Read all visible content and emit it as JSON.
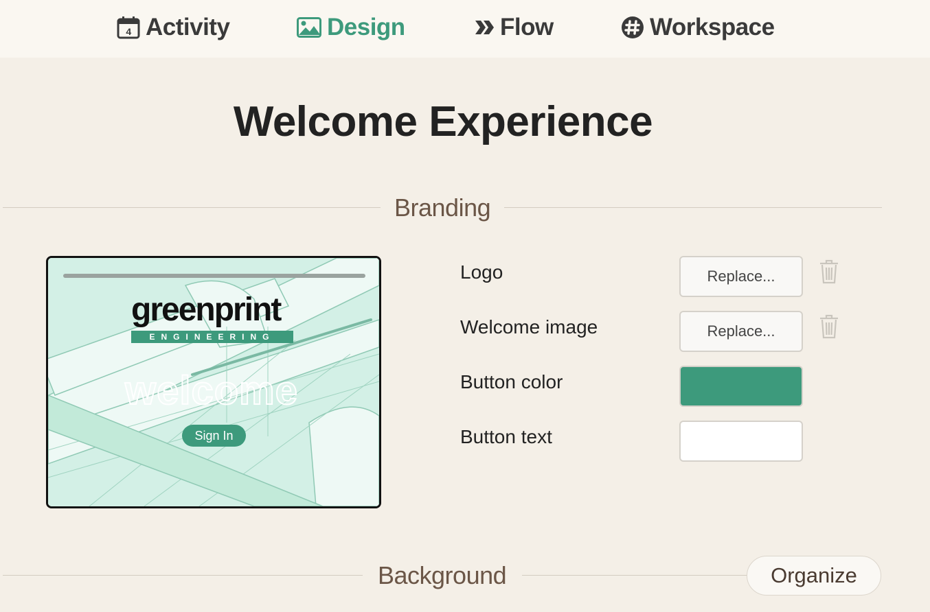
{
  "nav": {
    "items": [
      {
        "label": "Activity",
        "icon": "calendar-icon",
        "calendar_day": "4"
      },
      {
        "label": "Design",
        "icon": "image-icon",
        "active": true
      },
      {
        "label": "Flow",
        "icon": "double-chevron-icon"
      },
      {
        "label": "Workspace",
        "icon": "slack-icon"
      }
    ],
    "active_color": "#3d9a7c"
  },
  "page": {
    "title": "Welcome Experience"
  },
  "branding": {
    "heading": "Branding",
    "preview": {
      "logo_word": "greenprint",
      "logo_sub": "ENGINEERING",
      "welcome_word": "welcome",
      "signin_label": "Sign In"
    },
    "rows": {
      "logo_label": "Logo",
      "welcome_image_label": "Welcome image",
      "button_color_label": "Button color",
      "button_text_label": "Button text",
      "replace_label": "Replace..."
    },
    "button_color": "#3d9a7c",
    "button_text_color": "#ffffff"
  },
  "background": {
    "heading": "Background",
    "organize_label": "Organize"
  }
}
